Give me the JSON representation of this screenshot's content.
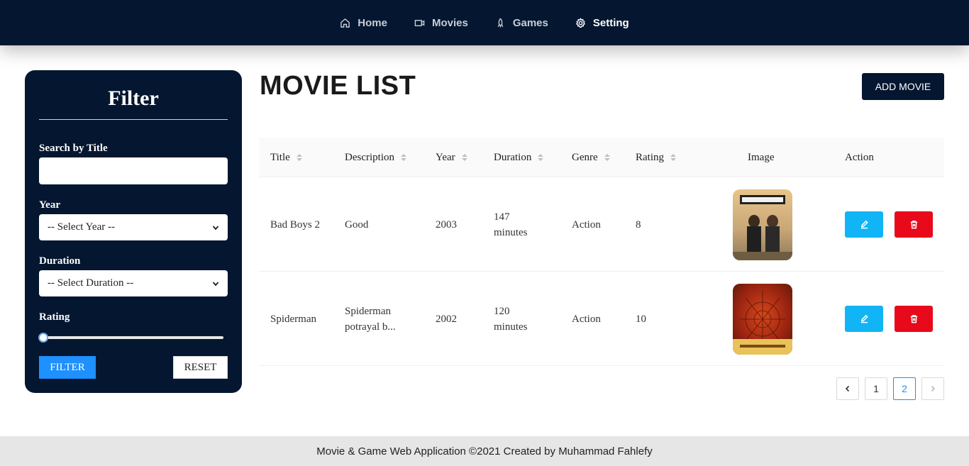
{
  "nav": {
    "items": [
      {
        "label": "Home",
        "icon": "home-icon"
      },
      {
        "label": "Movies",
        "icon": "video-icon"
      },
      {
        "label": "Games",
        "icon": "rocket-icon"
      },
      {
        "label": "Setting",
        "icon": "gear-icon"
      }
    ]
  },
  "filter": {
    "title": "Filter",
    "search_label": "Search by Title",
    "search_value": "",
    "year_label": "Year",
    "year_selected": "-- Select Year --",
    "duration_label": "Duration",
    "duration_selected": "-- Select Duration --",
    "rating_label": "Rating",
    "rating_value": 0,
    "filter_button": "FILTER",
    "reset_button": "RESET"
  },
  "main": {
    "title": "MOVIE LIST",
    "add_button": "ADD MOVIE"
  },
  "table": {
    "columns": [
      "Title",
      "Description",
      "Year",
      "Duration",
      "Genre",
      "Rating",
      "Image",
      "Action"
    ],
    "rows": [
      {
        "title": "Bad Boys 2",
        "description": "Good",
        "year": "2003",
        "duration": "147 minutes",
        "genre": "Action",
        "rating": "8",
        "image": "bad-boys-poster"
      },
      {
        "title": "Spiderman",
        "description": "Spiderman potrayal b...",
        "year": "2002",
        "duration": "120 minutes",
        "genre": "Action",
        "rating": "10",
        "image": "spiderman-poster"
      }
    ]
  },
  "pagination": {
    "pages": [
      "1",
      "2"
    ],
    "current": "2"
  },
  "footer": {
    "text": "Movie & Game Web Application ©2021 Created by Muhammad Fahlefy"
  },
  "colors": {
    "navy": "#041630",
    "primary": "#1e90ff",
    "edit": "#11b4f5",
    "delete": "#e8091b"
  }
}
